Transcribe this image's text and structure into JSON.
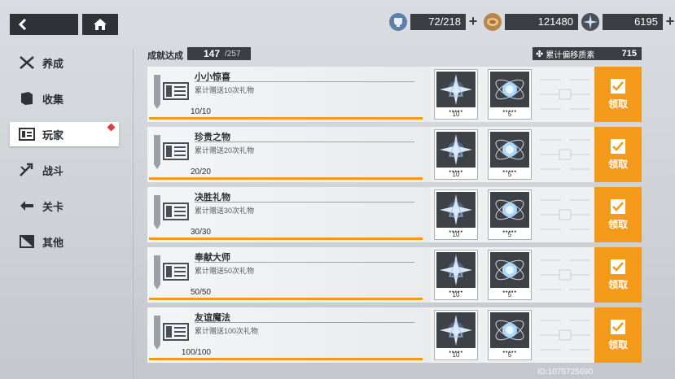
{
  "nav": {
    "back_icon": "chevron-left-icon",
    "home_icon": "home-icon"
  },
  "currencies": [
    {
      "icon": "cup-icon",
      "value": "72/218"
    },
    {
      "icon": "coin-icon",
      "value": "121480"
    },
    {
      "icon": "crystal-icon",
      "value": "6195"
    }
  ],
  "sidebar": {
    "items": [
      {
        "label": "养成",
        "icon": "swords-icon"
      },
      {
        "label": "收集",
        "icon": "book-icon"
      },
      {
        "label": "玩家",
        "icon": "id-card-icon",
        "active": true
      },
      {
        "label": "战斗",
        "icon": "battle-icon"
      },
      {
        "label": "关卡",
        "icon": "stage-icon"
      },
      {
        "label": "其他",
        "icon": "other-icon"
      }
    ]
  },
  "header": {
    "achievement_label": "成就达成",
    "achievement_current": "147",
    "achievement_total": "/257",
    "offset_label": "累计偏移质素",
    "offset_value": "715"
  },
  "rows": [
    {
      "title": "小小惊喜",
      "desc": "累计赠送10次礼物",
      "progress": "10/10",
      "progress_fraction": 1.0,
      "rewards": [
        {
          "icon": "star-crystal-icon",
          "qty": "10"
        },
        {
          "icon": "orbit-orb-icon",
          "qty": "5"
        }
      ],
      "claim": "领取"
    },
    {
      "title": "珍贵之物",
      "desc": "累计赠送20次礼物",
      "progress": "20/20",
      "progress_fraction": 1.0,
      "rewards": [
        {
          "icon": "star-crystal-icon",
          "qty": "10"
        },
        {
          "icon": "orbit-orb-icon",
          "qty": "5"
        }
      ],
      "claim": "领取"
    },
    {
      "title": "决胜礼物",
      "desc": "累计赠送30次礼物",
      "progress": "30/30",
      "progress_fraction": 1.0,
      "rewards": [
        {
          "icon": "star-crystal-icon",
          "qty": "10"
        },
        {
          "icon": "orbit-orb-icon",
          "qty": "5"
        }
      ],
      "claim": "领取"
    },
    {
      "title": "奉献大师",
      "desc": "累计赠送50次礼物",
      "progress": "50/50",
      "progress_fraction": 1.0,
      "rewards": [
        {
          "icon": "star-crystal-icon",
          "qty": "10"
        },
        {
          "icon": "orbit-orb-icon",
          "qty": "5"
        }
      ],
      "claim": "领取"
    },
    {
      "title": "友谊魔法",
      "desc": "累计赠送100次礼物",
      "progress": "100/100",
      "progress_fraction": 1.0,
      "rewards": [
        {
          "icon": "star-crystal-icon",
          "qty": "10"
        },
        {
          "icon": "orbit-orb-icon",
          "qty": "5"
        }
      ],
      "claim": "领取"
    }
  ],
  "footer": {
    "uid": "ID:1075725690"
  },
  "colors": {
    "accent": "#f39a1b",
    "dark": "#3a3d42",
    "badge": "#e23b3b"
  }
}
